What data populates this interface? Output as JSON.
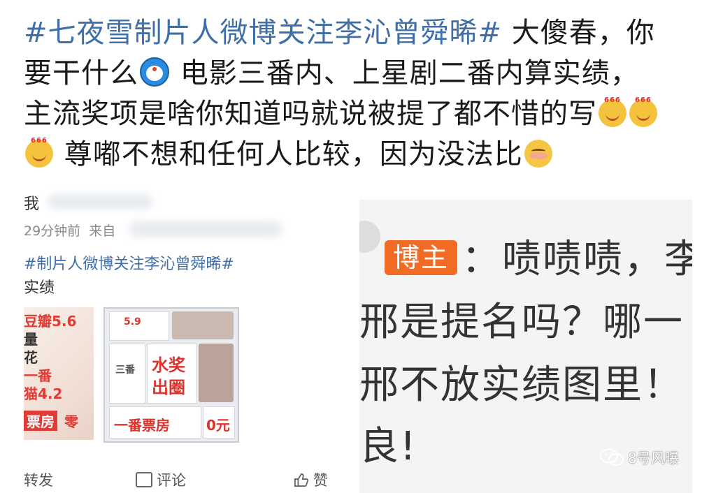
{
  "post": {
    "hashtag": "#七夜雪制片人微博关注李沁曾舜晞#",
    "line1_rest": " 大傻春，你",
    "line2": "要干什么",
    "line2_rest": " 电影三番内、上星剧二番内算实绩，",
    "line3": "主流奖项是啥你知道吗就说被提了都不惜的写",
    "line4": " 尊嘟不想和任何人比较，因为没法比"
  },
  "emojis": [
    "doraemon-emoji",
    "666-emoji",
    "666-emoji",
    "666-emoji",
    "shy-emoji"
  ],
  "left_screenshot": {
    "user_name": "我",
    "meta_time": "29分钟前",
    "meta_from": "来自",
    "hashtag": "#制片人微博关注李沁曾舜晞#",
    "text": "实绩",
    "image_a_tags": [
      "豆瓣5.6",
      "量",
      "花",
      "一番",
      "猫4.2",
      "票房",
      "零"
    ],
    "image_b_labels": [
      "水奖",
      "出圈",
      "一番票房",
      "0元",
      "5.9",
      "三番"
    ],
    "actions": {
      "repost": "转发",
      "comment": "评论",
      "like": "赞"
    }
  },
  "right_screenshot": {
    "badge": "博主",
    "line1": "：啧啧啧，李",
    "line2": "邢是提名吗？哪一",
    "line3": "邢不放实绩图里！",
    "line4": "良!"
  },
  "watermark": {
    "text": "8号风曝"
  },
  "colors": {
    "hashtag_blue": "#3f6fa8",
    "badge_orange": "#f26b25",
    "highlight_red": "#e0322c"
  }
}
